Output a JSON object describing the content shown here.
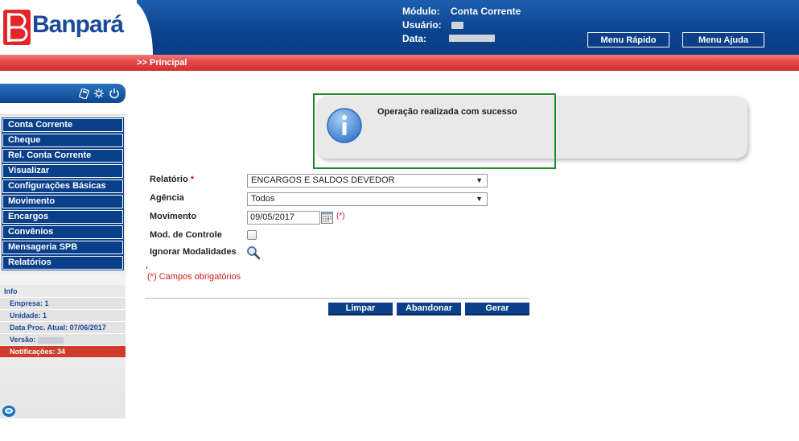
{
  "header": {
    "brand": "Banpará",
    "modulo_label": "Módulo:",
    "modulo_value": "Conta Corrente",
    "usuario_label": "Usuário:",
    "data_label": "Data:",
    "menu_rapido": "Menu Rápido",
    "menu_ajuda": "Menu Ajuda"
  },
  "breadcrumb": ">> Principal",
  "sidebar": {
    "items": [
      {
        "label": "Conta Corrente"
      },
      {
        "label": "Cheque"
      },
      {
        "label": "Rel. Conta Corrente"
      },
      {
        "label": "Visualizar"
      },
      {
        "label": "Configurações Básicas"
      },
      {
        "label": "Movimento"
      },
      {
        "label": "Encargos"
      },
      {
        "label": "Convênios"
      },
      {
        "label": "Mensageria SPB"
      },
      {
        "label": "Relatórios"
      }
    ],
    "info": {
      "title": "Info",
      "empresa": "Empresa: 1",
      "unidade": "Unidade: 1",
      "data_proc": "Data Proc. Atual: 07/06/2017",
      "versao": "Versão:",
      "notificacoes": "Notificações: 34"
    }
  },
  "message": {
    "text": "Operação realizada com sucesso"
  },
  "form": {
    "relatorio_label": "Relatório",
    "required_marker": "*",
    "relatorio_value": "ENCARGOS E SALDOS DEVEDOR",
    "agencia_label": "Agência",
    "agencia_value": "Todos",
    "movimento_label": "Movimento",
    "movimento_value": "09/05/2017",
    "movimento_req": "(*)",
    "mod_controle_label": "Mod. de Controle",
    "ignorar_label": "Ignorar Modalidades",
    "required_note": "(*) Campos obrigatórios",
    "buttons": {
      "limpar": "Limpar",
      "abandonar": "Abandonar",
      "gerar": "Gerar"
    }
  },
  "colors": {
    "header_blue": "#0c4490",
    "red_bar": "#e14848",
    "menu_blue": "#0a3f8a",
    "success_border": "#1f8a2c",
    "required_red": "#d01a1a"
  }
}
